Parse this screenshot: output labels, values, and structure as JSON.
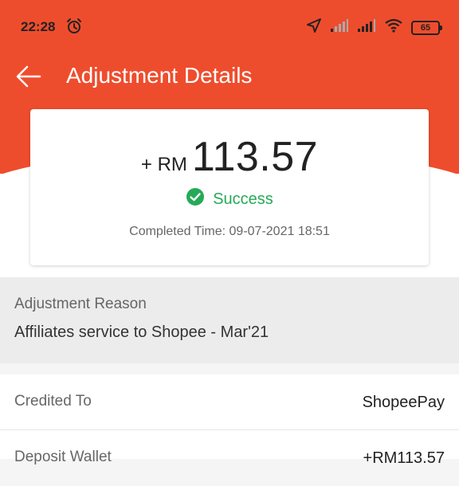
{
  "status_bar": {
    "time": "22:28",
    "battery": "65"
  },
  "header": {
    "title": "Adjustment Details",
    "accent_color": "#ee4d2d"
  },
  "summary": {
    "amount_prefix": "+ RM",
    "amount_value": "113.57",
    "status": "Success",
    "status_color": "#26aa57",
    "completed_time": "Completed Time: 09-07-2021 18:51"
  },
  "reason": {
    "label": "Adjustment Reason",
    "value": "Affiliates service to Shopee - Mar'21"
  },
  "details": [
    {
      "label": "Credited To",
      "value": "ShopeePay"
    },
    {
      "label": "Deposit Wallet",
      "value": "+RM113.57"
    }
  ],
  "icons": {
    "back": "arrow-left-icon",
    "alarm": "alarm-clock-icon",
    "location": "location-arrow-icon",
    "signal": "cell-signal-icon",
    "wifi": "wifi-icon",
    "battery": "battery-icon",
    "success": "check-circle-icon"
  }
}
